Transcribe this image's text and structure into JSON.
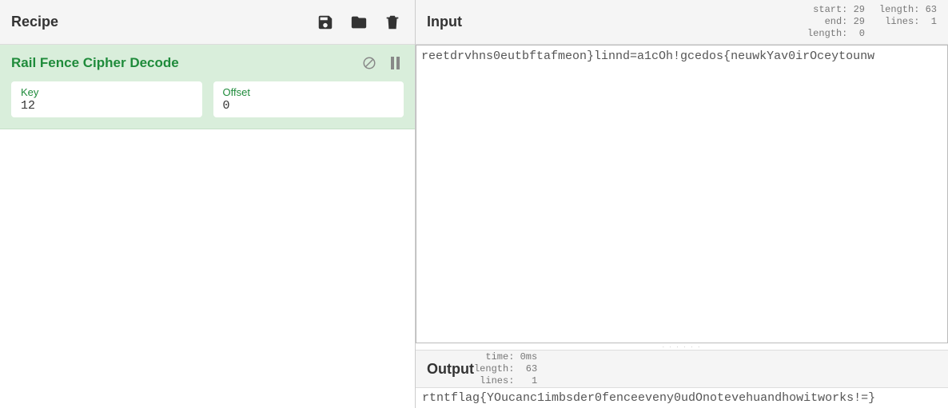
{
  "recipe": {
    "title": "Recipe",
    "icons": {
      "save": "save-icon",
      "open": "folder-icon",
      "delete": "trash-icon"
    },
    "operations": [
      {
        "name": "Rail Fence Cipher Decode",
        "args": [
          {
            "label": "Key",
            "value": "12"
          },
          {
            "label": "Offset",
            "value": "0"
          }
        ]
      }
    ]
  },
  "input": {
    "title": "Input",
    "stats_left": {
      "start": "29",
      "end": "29",
      "length": "0"
    },
    "stats_right": {
      "length": "63",
      "lines": "1"
    },
    "text": "reetdrvhns0eutbftafmeon}linnd=a1cOh!gcedos{neuwkYav0irOceytounw"
  },
  "output": {
    "title": "Output",
    "stats": {
      "time": "0ms",
      "length": "63",
      "lines": "1"
    },
    "text": "rtntflag{YOucanc1imbsder0fenceeveny0udOnotevehuandhowitworks!=}"
  }
}
